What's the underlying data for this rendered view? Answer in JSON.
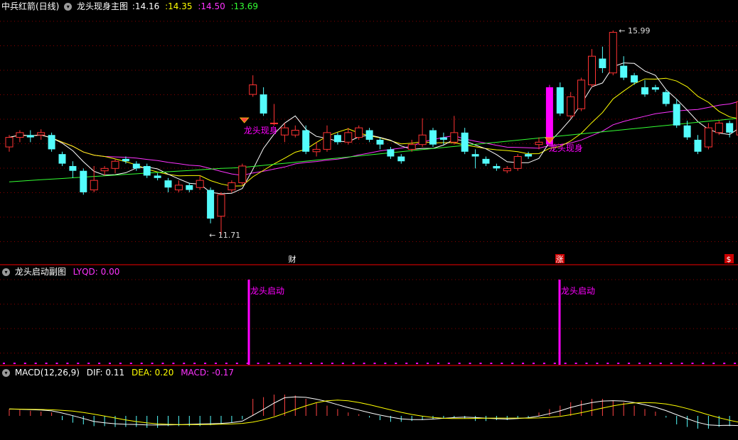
{
  "main": {
    "stock_title": "中兵红箭(日线)",
    "indicator": "龙头现身主图",
    "values": [
      {
        "text": ":14.16",
        "color": "#ffffff"
      },
      {
        "text": ":14.35",
        "color": "#ffff00"
      },
      {
        "text": ":14.50",
        "color": "#ff33ff"
      },
      {
        "text": ":13.69",
        "color": "#33ff33"
      }
    ],
    "high_label": "15.99",
    "low_label": "11.71",
    "signal_label": "龙头现身",
    "markers": [
      {
        "text": "财",
        "x": 411,
        "bg": "transparent",
        "color": "#ffffff"
      },
      {
        "text": "涨",
        "x": 787,
        "bg": "#cc0000",
        "color": "#ffffff"
      },
      {
        "text": "$",
        "x": 1025,
        "bg": "#cc0000",
        "color": "#ffffff"
      }
    ]
  },
  "sub1": {
    "name": "龙头启动副图",
    "value_label": "LYQD: 0.00",
    "signal_label": "龙头启动"
  },
  "sub2": {
    "name": "MACD(12,26,9)",
    "dif": "DIF: 0.11",
    "dea": "DEA: 0.20",
    "macd": "MACD: -0.17"
  },
  "colors": {
    "bg": "#000000",
    "up": "#ff3333",
    "down": "#54fcfc",
    "ma5": "#ffffff",
    "ma10": "#ffff00",
    "ma20": "#ff33ff",
    "ma60": "#33ff33",
    "grid": "#8b0000",
    "signal": "#ff00ff"
  },
  "chart_data": {
    "type": "candlestick",
    "y_range": [
      11.5,
      16.3
    ],
    "high_marker": 15.99,
    "low_marker": 11.71,
    "candles": [
      [
        13.55,
        13.75,
        13.8,
        13.45
      ],
      [
        13.75,
        13.85,
        13.9,
        13.65
      ],
      [
        13.8,
        13.75,
        13.9,
        13.65
      ],
      [
        13.8,
        13.85,
        13.92,
        13.7
      ],
      [
        13.8,
        13.5,
        13.85,
        13.45
      ],
      [
        13.4,
        13.2,
        13.45,
        13.15
      ],
      [
        13.15,
        13.05,
        13.25,
        12.9
      ],
      [
        13.05,
        12.6,
        13.1,
        12.55
      ],
      [
        12.65,
        12.85,
        13.15,
        12.6
      ],
      [
        13.05,
        13.1,
        13.15,
        12.95
      ],
      [
        13.1,
        13.25,
        13.3,
        13.0
      ],
      [
        13.3,
        13.25,
        13.35,
        13.2
      ],
      [
        13.2,
        13.1,
        13.25,
        13.05
      ],
      [
        13.15,
        12.95,
        13.2,
        12.9
      ],
      [
        12.95,
        12.9,
        13.0,
        12.85
      ],
      [
        12.85,
        12.7,
        12.9,
        12.6
      ],
      [
        12.65,
        12.75,
        12.85,
        12.6
      ],
      [
        12.75,
        12.65,
        12.8,
        12.6
      ],
      [
        12.7,
        12.85,
        12.95,
        12.65
      ],
      [
        12.65,
        12.05,
        12.7,
        11.95
      ],
      [
        12.1,
        12.55,
        12.6,
        11.71
      ],
      [
        12.65,
        12.8,
        12.85,
        12.6
      ],
      [
        12.8,
        13.15,
        13.2,
        12.75
      ],
      [
        14.65,
        14.85,
        15.05,
        14.6
      ],
      [
        14.65,
        14.25,
        14.8,
        14.2
      ],
      [
        14.05,
        14.05,
        14.45,
        14.0
      ],
      [
        13.8,
        13.95,
        14.05,
        13.65
      ],
      [
        13.8,
        13.9,
        14.0,
        13.75
      ],
      [
        13.9,
        13.45,
        14.0,
        13.4
      ],
      [
        13.45,
        13.5,
        13.65,
        13.35
      ],
      [
        13.5,
        13.85,
        14.0,
        13.45
      ],
      [
        13.8,
        13.65,
        13.85,
        13.6
      ],
      [
        13.65,
        13.85,
        13.95,
        13.6
      ],
      [
        13.75,
        13.95,
        14.0,
        13.7
      ],
      [
        13.9,
        13.7,
        13.95,
        13.65
      ],
      [
        13.7,
        13.6,
        13.75,
        13.5
      ],
      [
        13.5,
        13.35,
        13.55,
        13.3
      ],
      [
        13.35,
        13.25,
        13.4,
        13.2
      ],
      [
        13.5,
        13.6,
        13.7,
        13.45
      ],
      [
        13.6,
        13.8,
        14.15,
        13.55
      ],
      [
        13.9,
        13.6,
        13.95,
        13.55
      ],
      [
        13.75,
        13.7,
        13.85,
        13.6
      ],
      [
        13.65,
        13.85,
        14.2,
        13.6
      ],
      [
        13.85,
        13.45,
        13.95,
        13.4
      ],
      [
        13.4,
        13.35,
        13.5,
        13.1
      ],
      [
        13.3,
        13.2,
        13.35,
        13.15
      ],
      [
        13.15,
        13.1,
        13.2,
        13.05
      ],
      [
        13.05,
        13.1,
        13.15,
        13.0
      ],
      [
        13.1,
        13.35,
        13.4,
        13.05
      ],
      [
        13.4,
        13.35,
        13.45,
        13.3
      ],
      [
        13.6,
        13.65,
        13.75,
        13.5
      ],
      [
        13.6,
        14.8,
        14.85,
        13.6
      ],
      [
        14.8,
        14.25,
        14.9,
        14.2
      ],
      [
        14.2,
        14.6,
        14.7,
        14.15
      ],
      [
        14.35,
        14.95,
        15.0,
        14.3
      ],
      [
        14.85,
        15.45,
        15.6,
        14.8
      ],
      [
        15.4,
        15.2,
        15.65,
        15.1
      ],
      [
        15.1,
        15.95,
        15.99,
        15.05
      ],
      [
        15.25,
        15.0,
        15.45,
        14.95
      ],
      [
        15.05,
        14.9,
        15.1,
        14.85
      ],
      [
        14.8,
        14.65,
        14.95,
        14.6
      ],
      [
        14.8,
        14.75,
        14.85,
        14.7
      ],
      [
        14.7,
        14.45,
        14.75,
        14.4
      ],
      [
        14.45,
        14.0,
        14.55,
        13.95
      ],
      [
        14.0,
        13.75,
        14.1,
        13.7
      ],
      [
        13.7,
        13.45,
        13.8,
        13.4
      ],
      [
        13.55,
        13.95,
        14.05,
        13.5
      ],
      [
        13.85,
        14.05,
        14.1,
        13.8
      ],
      [
        14.05,
        13.85,
        14.1,
        13.75
      ],
      [
        13.8,
        14.5,
        14.7,
        13.75
      ]
    ],
    "macd_hist": [
      0.08,
      0.07,
      0.06,
      0.05,
      0.04,
      -0.05,
      -0.08,
      -0.1,
      -0.12,
      -0.12,
      -0.13,
      -0.13,
      -0.13,
      -0.14,
      -0.14,
      -0.12,
      -0.12,
      -0.12,
      -0.12,
      -0.11,
      -0.1,
      -0.08,
      -0.04,
      0.2,
      0.22,
      0.25,
      0.25,
      0.24,
      0.2,
      0.15,
      0.12,
      0.08,
      0.04,
      0.02,
      -0.02,
      -0.05,
      -0.07,
      -0.07,
      -0.06,
      -0.05,
      -0.04,
      -0.03,
      -0.02,
      -0.03,
      -0.06,
      -0.06,
      -0.05,
      -0.05,
      -0.03,
      -0.02,
      0.04,
      0.08,
      0.12,
      0.16,
      0.18,
      0.2,
      0.2,
      0.18,
      0.16,
      0.12,
      0.08,
      0.05,
      -0.02,
      -0.1,
      -0.13,
      -0.15,
      -0.15,
      -0.13,
      -0.12,
      -0.17
    ]
  }
}
